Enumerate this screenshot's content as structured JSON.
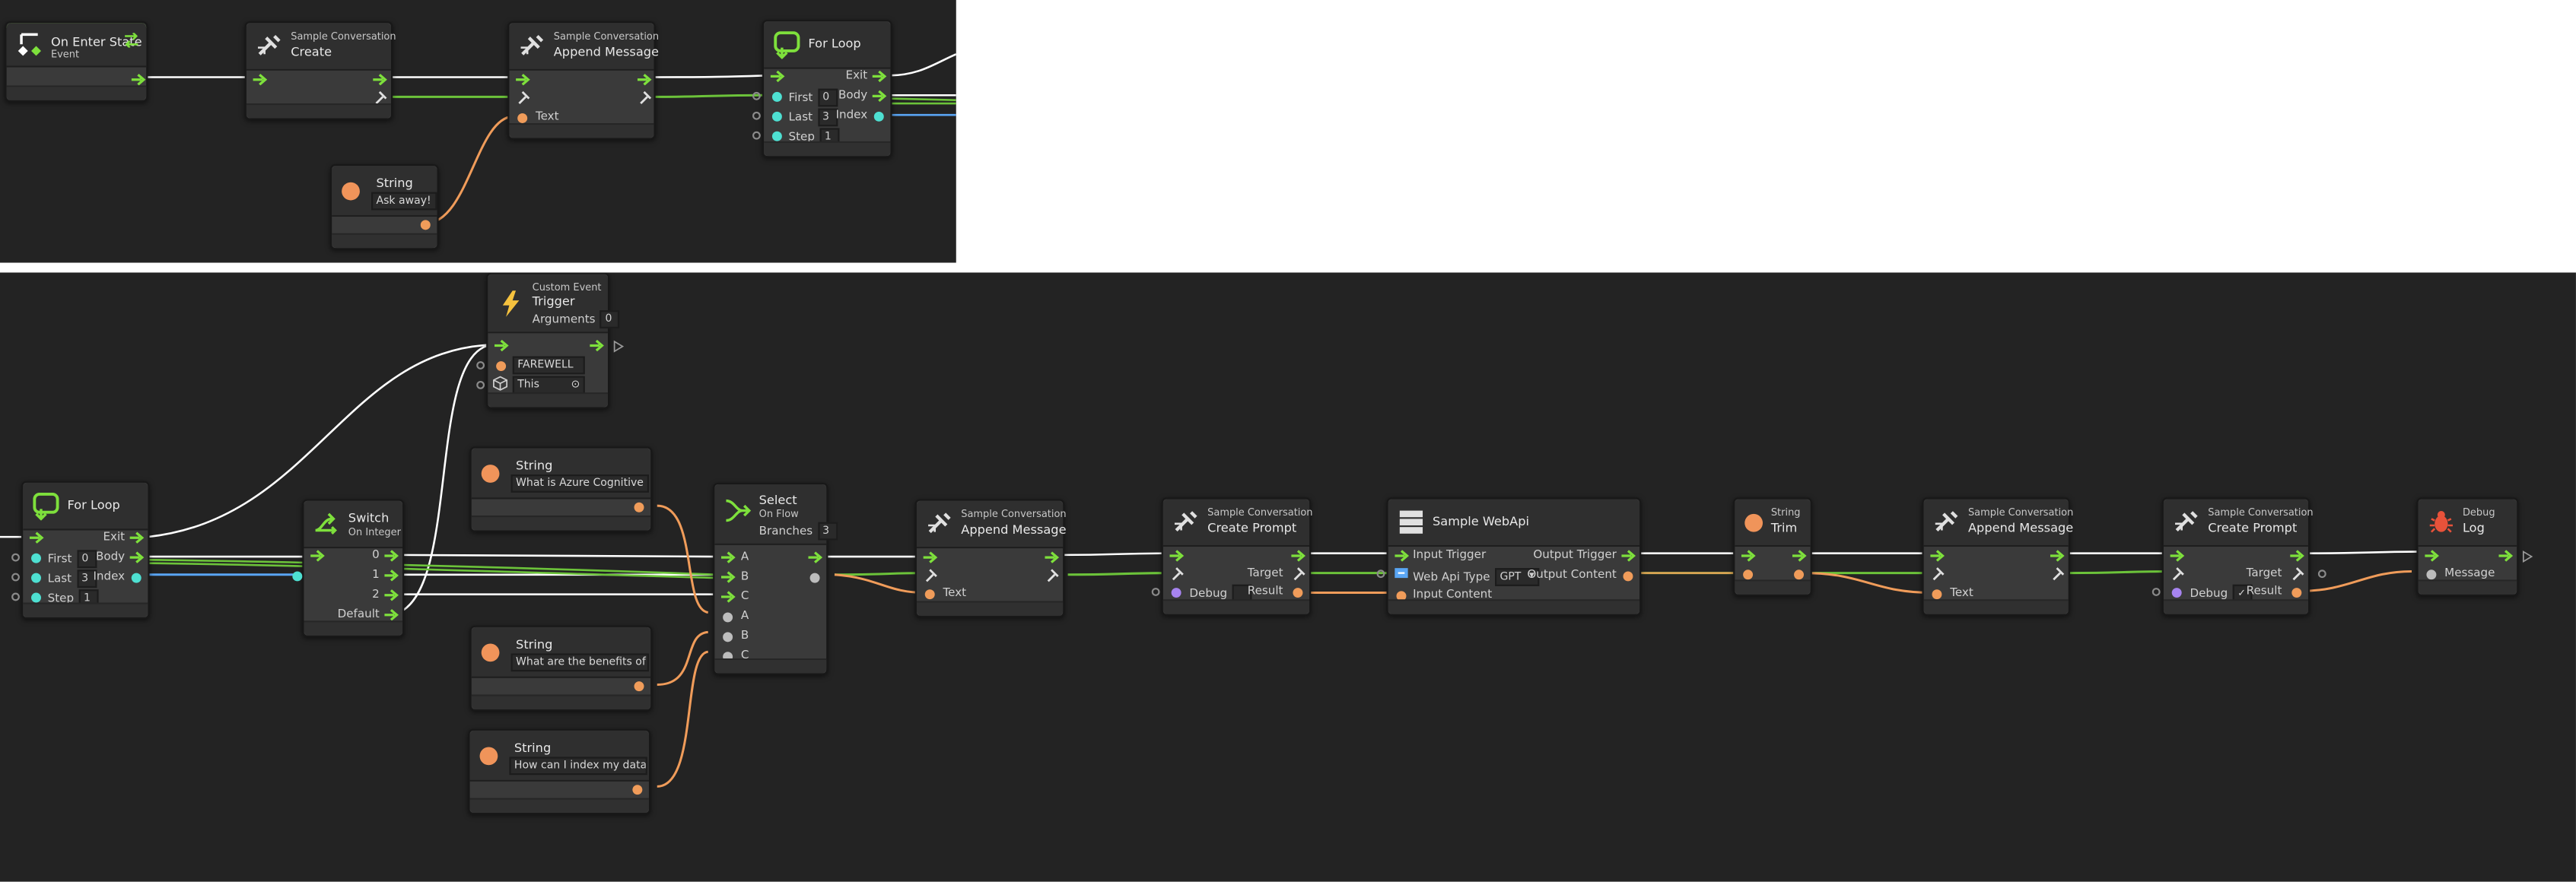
{
  "graph1": {
    "on_enter": {
      "title": "On Enter State",
      "subtitle": "Event"
    },
    "create": {
      "subtitle": "Sample Conversation",
      "title": "Create"
    },
    "append": {
      "subtitle": "Sample Conversation",
      "title": "Append Message",
      "text_port": "Text"
    },
    "for_loop": {
      "title": "For Loop",
      "exit": "Exit",
      "body": "Body",
      "index": "Index",
      "first": "First",
      "first_val": "0",
      "last": "Last",
      "last_val": "3",
      "step": "Step",
      "step_val": "1"
    },
    "string": {
      "title": "String",
      "value": "Ask away!"
    }
  },
  "graph2": {
    "custom_event": {
      "subtitle": "Custom Event",
      "title": "Trigger",
      "arguments_label": "Arguments",
      "arguments_val": "0",
      "name_val": "FAREWELL",
      "target_val": "This"
    },
    "for_loop": {
      "title": "For Loop",
      "exit": "Exit",
      "body": "Body",
      "index": "Index",
      "first": "First",
      "first_val": "0",
      "last": "Last",
      "last_val": "3",
      "step": "Step",
      "step_val": "1"
    },
    "switch": {
      "title": "Switch",
      "subtitle": "On Integer",
      "case0": "0",
      "case1": "1",
      "case2": "2",
      "default": "Default"
    },
    "string1": {
      "title": "String",
      "value": "What is Azure Cognitive S"
    },
    "string2": {
      "title": "String",
      "value": "What are the benefits of u"
    },
    "string3": {
      "title": "String",
      "value": "How can I index my data w"
    },
    "select": {
      "title": "Select",
      "subtitle": "On Flow",
      "branches_label": "Branches",
      "branches_val": "3",
      "a": "A",
      "b": "B",
      "c": "C"
    },
    "append1": {
      "subtitle": "Sample Conversation",
      "title": "Append Message",
      "text_port": "Text"
    },
    "create_prompt1": {
      "subtitle": "Sample Conversation",
      "title": "Create Prompt",
      "target": "Target",
      "debug": "Debug",
      "result": "Result"
    },
    "webapi": {
      "title": "Sample WebApi",
      "input_trigger": "Input Trigger",
      "output_trigger": "Output Trigger",
      "api_type_label": "Web Api Type",
      "api_type_val": "GPT",
      "output_content": "Output Content",
      "input_content": "Input Content"
    },
    "trim": {
      "subtitle": "String",
      "title": "Trim"
    },
    "append2": {
      "subtitle": "Sample Conversation",
      "title": "Append Message",
      "text_port": "Text"
    },
    "create_prompt2": {
      "subtitle": "Sample Conversation",
      "title": "Create Prompt",
      "target": "Target",
      "debug": "Debug",
      "result": "Result"
    },
    "debug_log": {
      "subtitle": "Debug",
      "title": "Log",
      "message": "Message"
    }
  },
  "colors": {
    "canvas": "#232323",
    "flow": "#ffffff",
    "object_port": "#6cc33a",
    "string_port": "#f09c5a",
    "int_port": "#4ee0d2",
    "index_wire": "#5aa6f5",
    "flow_arrow": "#7ee03c"
  }
}
